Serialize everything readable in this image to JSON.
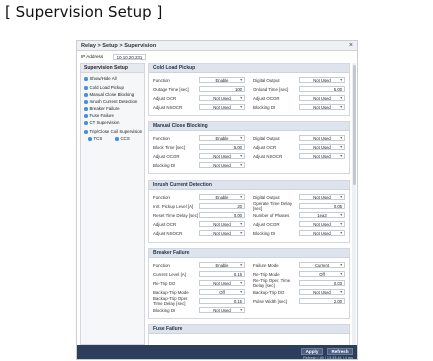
{
  "page_heading": "[ Supervision Setup ]",
  "window": {
    "breadcrumb": "Relay > Setup > Supervision",
    "close_symbol": "×",
    "ip_label": "IP Address",
    "ip_value": "10.10.20.231"
  },
  "sidebar": {
    "title": "Supervision Setup",
    "items": [
      {
        "label": "Show/Hide All"
      },
      {
        "label": "Cold Load Pickup"
      },
      {
        "label": "Manual Close Blocking"
      },
      {
        "label": "Inrush Current Detection"
      },
      {
        "label": "Breaker Failure"
      },
      {
        "label": "Fuse Failure"
      },
      {
        "label": "CT Supervision"
      },
      {
        "label": "Trip/Close Coil Supervision"
      },
      {
        "label": "TCS"
      },
      {
        "label": "CCS"
      }
    ]
  },
  "sections": {
    "cold_load": {
      "title": "Cold Load Pickup",
      "fields": [
        {
          "label": "Function",
          "value": "Enable"
        },
        {
          "label": "Outage Time [sec]",
          "value": "100"
        },
        {
          "label": "Adjust OCR",
          "value": "Not Used"
        },
        {
          "label": "Adjust NSOCR",
          "value": "Not Used"
        },
        {
          "label": "Digital Output",
          "value": "Not Used"
        },
        {
          "label": "Onload Time [sec]",
          "value": "5.00"
        },
        {
          "label": "Adjust OCGR",
          "value": "Not Used"
        },
        {
          "label": "Blocking DI",
          "value": "Not Used"
        }
      ]
    },
    "manual_close": {
      "title": "Manual Close Blocking",
      "fields": [
        {
          "label": "Function",
          "value": "Enable"
        },
        {
          "label": "Block Time [sec]",
          "value": "5.00"
        },
        {
          "label": "Adjust OCGR",
          "value": "Not Used"
        },
        {
          "label": "Blocking DI",
          "value": "Not Used"
        },
        {
          "label": "Digital Output",
          "value": "Not Used"
        },
        {
          "label": "Adjust OCR",
          "value": "Not Used"
        },
        {
          "label": "Adjust NSOCR",
          "value": "Not Used"
        }
      ]
    },
    "inrush": {
      "title": "Inrush Current Detection",
      "fields": [
        {
          "label": "Function",
          "value": "Enable"
        },
        {
          "label": "Inrt. Pickup Level [A]",
          "value": "20"
        },
        {
          "label": "Reset Time Delay [sec]",
          "value": "0.00"
        },
        {
          "label": "Adjust OCR",
          "value": "Not Used"
        },
        {
          "label": "Adjust NSOCR",
          "value": "Not Used"
        },
        {
          "label": "Digital Output",
          "value": "Not Used"
        },
        {
          "label": "Operate Time Delay [sec]",
          "value": "0.05"
        },
        {
          "label": "Number of Phases",
          "value": "1ea3"
        },
        {
          "label": "Adjust OCGR",
          "value": "Not Used"
        },
        {
          "label": "Blocking DI",
          "value": "Not Used"
        }
      ]
    },
    "breaker": {
      "title": "Breaker Failure",
      "fields": [
        {
          "label": "Function",
          "value": "Enable"
        },
        {
          "label": "Current Level [A]",
          "value": "0.15"
        },
        {
          "label": "Re-Trip DO",
          "value": "Not Used"
        },
        {
          "label": "Backup-Trip Mode",
          "value": "Off"
        },
        {
          "label": "Backup-Trip Oper. Time Delay [sec]",
          "value": "0.15"
        },
        {
          "label": "Blocking DI",
          "value": "Not Used"
        },
        {
          "label": "Failure Mode",
          "value": "Current"
        },
        {
          "label": "Re-Trip Mode",
          "value": "Off"
        },
        {
          "label": "Re-Trip Oper. Time Delay [sec]",
          "value": "0.03"
        },
        {
          "label": "Backup-Trip DO",
          "value": "Not Used"
        },
        {
          "label": "Pulse Width [sec]",
          "value": "2.00"
        }
      ]
    },
    "fuse": {
      "title": "Fuse Failure"
    }
  },
  "footer": {
    "apply_label": "Apply",
    "refresh_label": "Refresh",
    "status": "Refresh | #5 | 13:33:44 | 4 ms"
  }
}
